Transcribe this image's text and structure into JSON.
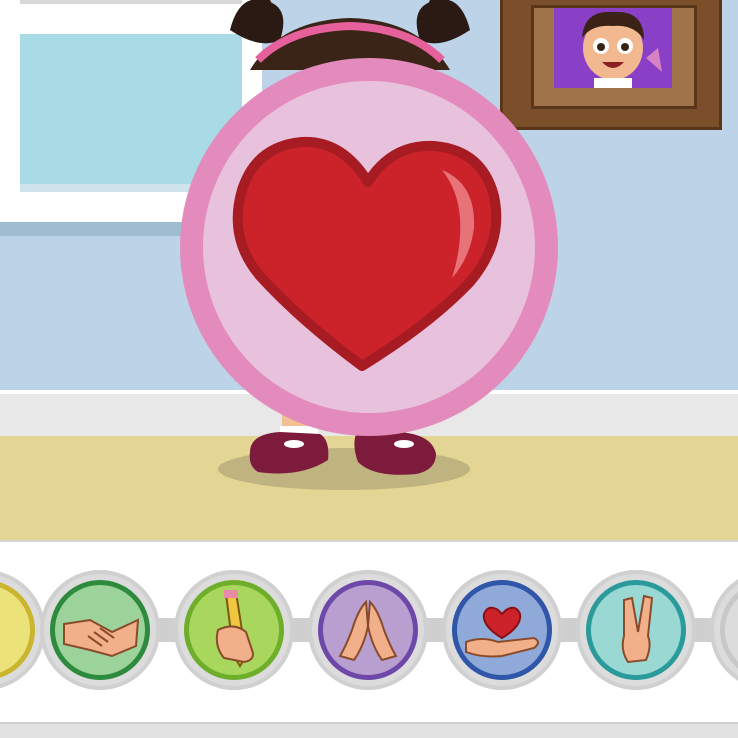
{
  "colors": {
    "wall": "#bcd3e8",
    "floor": "#e3d594",
    "balloon_outer": "#e48bbd",
    "balloon_inner": "#e8c2dd",
    "heart": "#cc2229",
    "heart_outline": "#a61c22"
  },
  "gestures": [
    {
      "icon": "partial-gesture-icon",
      "fill": "#ebe27a",
      "ring": "#c9b52e"
    },
    {
      "icon": "handshake-icon",
      "fill": "#9bd39a",
      "ring": "#2e8b3e"
    },
    {
      "icon": "pencil-hand-icon",
      "fill": "#a9d65c",
      "ring": "#6fae2a"
    },
    {
      "icon": "praying-hands-icon",
      "fill": "#b89fd0",
      "ring": "#6e48a8"
    },
    {
      "icon": "heart-in-hand-icon",
      "fill": "#8fa9d9",
      "ring": "#2f56a8"
    },
    {
      "icon": "peace-sign-icon",
      "fill": "#9ad8d4",
      "ring": "#2a9a9a"
    },
    {
      "icon": "partial-gesture-icon",
      "fill": "#dcdcdc",
      "ring": "#c8c8c8"
    }
  ]
}
